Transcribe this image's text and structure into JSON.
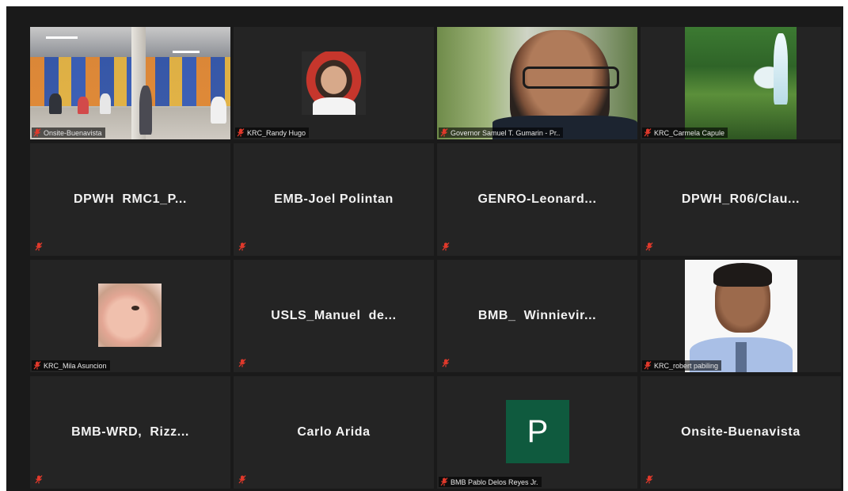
{
  "tiles": [
    {
      "kind": "video",
      "video": "room",
      "tag": "Onsite-Buenavista"
    },
    {
      "kind": "video",
      "video": "randy",
      "tag": "KRC_Randy Hugo"
    },
    {
      "kind": "video",
      "video": "gov",
      "tag": "Governor Samuel T. Gumarin - Pr..",
      "active": true
    },
    {
      "kind": "video",
      "video": "falls",
      "tag": "KRC_Carmela Capule"
    },
    {
      "kind": "name",
      "name": "DPWH  RMC1_P..."
    },
    {
      "kind": "name",
      "name": "EMB-Joel Polintan"
    },
    {
      "kind": "name",
      "name": "GENRO-Leonard..."
    },
    {
      "kind": "name",
      "name": "DPWH_R06/Clau..."
    },
    {
      "kind": "video",
      "video": "baby",
      "tag": "KRC_Mila Asuncion"
    },
    {
      "kind": "name",
      "name": "USLS_Manuel  de..."
    },
    {
      "kind": "name",
      "name": "BMB_  Winnievir..."
    },
    {
      "kind": "video",
      "video": "robert",
      "tag": "KRC_robert pabiling"
    },
    {
      "kind": "name",
      "name": "BMB-WRD,  Rizz..."
    },
    {
      "kind": "name",
      "name": "Carlo Arida"
    },
    {
      "kind": "avatar",
      "letter": "P",
      "tag": "BMB Pablo Delos Reyes Jr."
    },
    {
      "kind": "name",
      "name": "Onsite-Buenavista"
    }
  ],
  "icons": {
    "muted": "mic-muted-icon"
  },
  "colors": {
    "muted_icon": "#e0392b",
    "active_border": "#d8e14a",
    "avatar_bg": "#0f5a3e"
  }
}
